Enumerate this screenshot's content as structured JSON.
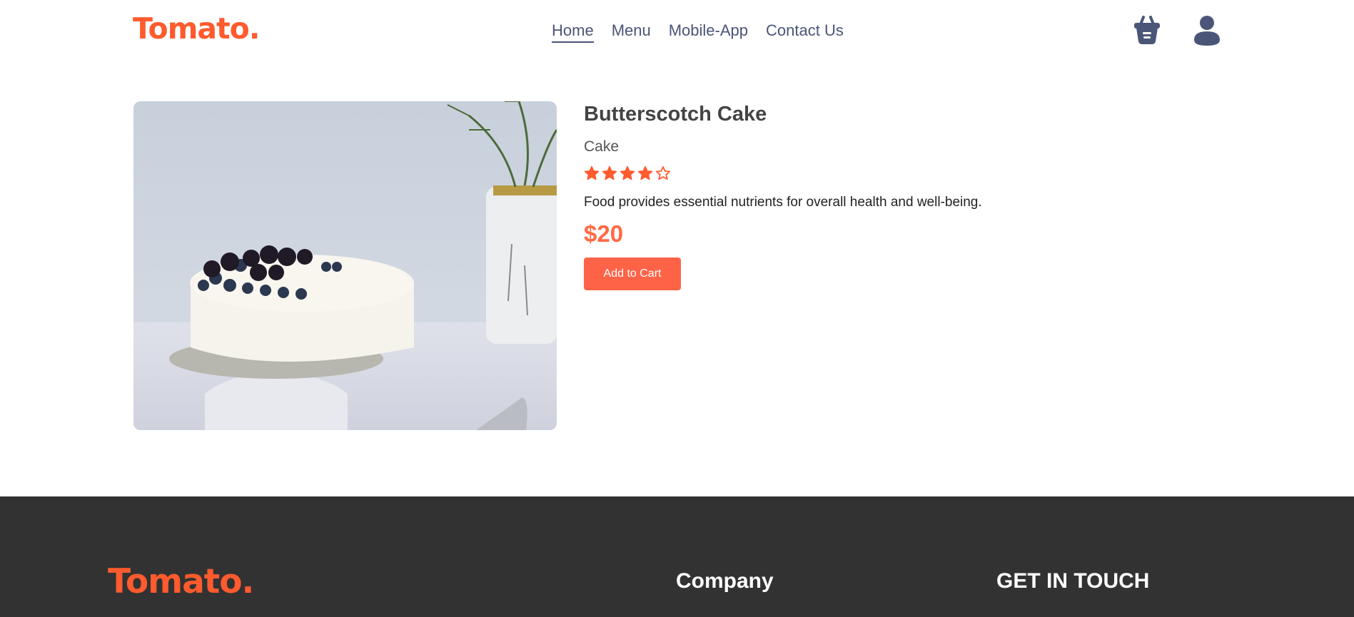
{
  "header": {
    "logo": "Tomato.",
    "nav": [
      "Home",
      "Menu",
      "Mobile-App",
      "Contact Us"
    ],
    "active_nav": "Home",
    "icons": [
      "basket-icon",
      "profile-icon"
    ]
  },
  "product": {
    "name": "Butterscotch Cake",
    "category": "Cake",
    "rating": 4,
    "rating_max": 5,
    "description": "Food provides essential nutrients for overall health and well-being.",
    "price": "$20",
    "add_to_cart_label": "Add to Cart"
  },
  "footer": {
    "logo": "Tomato.",
    "company_heading": "Company",
    "contact_heading": "GET IN TOUCH"
  },
  "colors": {
    "brand": "#ff5b2e",
    "button": "#ff6347",
    "nav_text": "#4a5578",
    "footer_bg": "#323232"
  }
}
